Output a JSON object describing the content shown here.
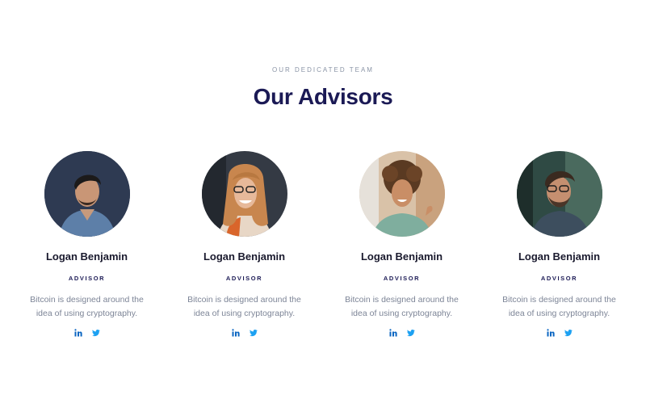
{
  "header": {
    "eyebrow": "OUR DEDICATED TEAM",
    "title": "Our Advisors"
  },
  "colors": {
    "title": "#1b1a55",
    "linkedin": "#0b66c2",
    "twitter": "#1da1f2"
  },
  "advisors": [
    {
      "name": "Logan Benjamin",
      "role": "ADVISOR",
      "bio": "Bitcoin is designed around the idea of using cryptography.",
      "photo": "man-portrait",
      "socials": [
        "linkedin-icon",
        "twitter-icon"
      ]
    },
    {
      "name": "Logan Benjamin",
      "role": "ADVISOR",
      "bio": "Bitcoin is designed around the idea of using cryptography.",
      "photo": "woman-portrait",
      "socials": [
        "linkedin-icon",
        "twitter-icon"
      ]
    },
    {
      "name": "Logan Benjamin",
      "role": "ADVISOR",
      "bio": "Bitcoin is designed around the idea of using cryptography.",
      "photo": "woman-portrait",
      "socials": [
        "linkedin-icon",
        "twitter-icon"
      ]
    },
    {
      "name": "Logan Benjamin",
      "role": "ADVISOR",
      "bio": "Bitcoin is designed around the idea of using cryptography.",
      "photo": "man-portrait",
      "socials": [
        "linkedin-icon",
        "twitter-icon"
      ]
    }
  ]
}
